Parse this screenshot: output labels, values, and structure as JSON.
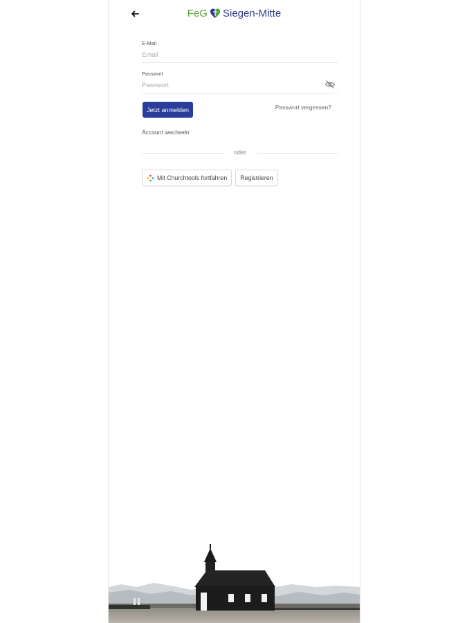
{
  "header": {
    "back_icon": "arrow-left-icon",
    "brand_left": "FeG",
    "brand_right": "Siegen-Mitte",
    "brand_green": "#5aa33a",
    "brand_blue": "#2e3a8c"
  },
  "form": {
    "email": {
      "label": "E-Mail",
      "placeholder": "Email",
      "value": ""
    },
    "password": {
      "label": "Passwort",
      "placeholder": "Passwort",
      "value": "",
      "toggle_icon": "eye-off-icon"
    },
    "submit_label": "Jetzt anmelden",
    "forgot_label": "Passwort vergessen?",
    "switch_account_label": "Account wechseln",
    "divider_label": "oder",
    "churchtools_label": "Mit Churchtools fortfahren",
    "register_label": "Registrieren",
    "primary_color": "#2a3d9a"
  }
}
